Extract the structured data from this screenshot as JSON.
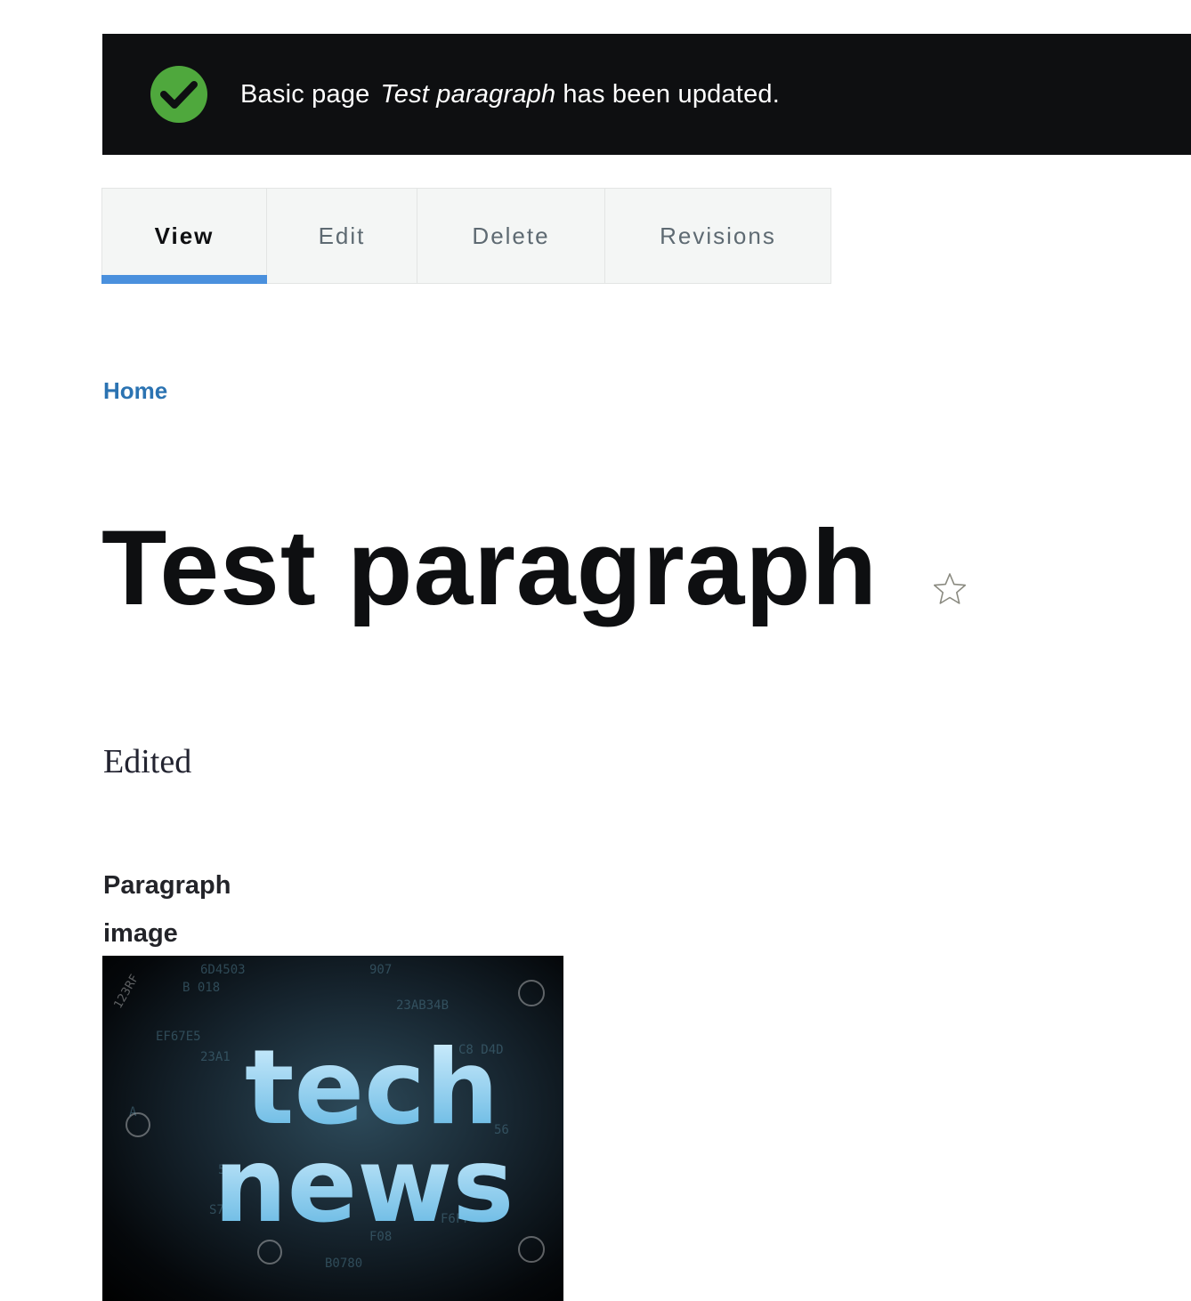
{
  "status": {
    "prefix": "Basic page",
    "title": "Test paragraph",
    "suffix": "has been updated."
  },
  "tabs": [
    {
      "label": "View",
      "active": true
    },
    {
      "label": "Edit",
      "active": false
    },
    {
      "label": "Delete",
      "active": false
    },
    {
      "label": "Revisions",
      "active": false
    }
  ],
  "breadcrumb": {
    "home": "Home"
  },
  "page": {
    "title": "Test paragraph",
    "body": "Edited",
    "field_label": "Paragraph image"
  },
  "image": {
    "line1": "tech",
    "line2": "news",
    "watermark": "123RF"
  },
  "colors": {
    "status_bg": "#0e0f11",
    "success": "#4fa83d",
    "tab_active_bar": "#4a90dd",
    "link": "#2b73b2"
  }
}
